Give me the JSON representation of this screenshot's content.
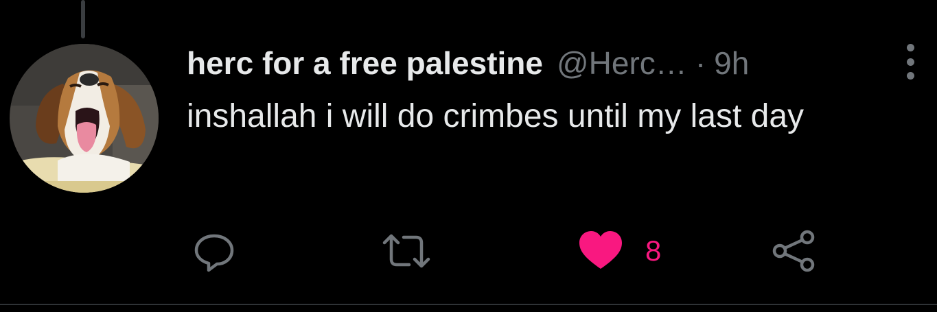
{
  "tweet": {
    "display_name": "herc for a free palestine",
    "handle": "@Herc…",
    "separator": "·",
    "timestamp": "9h",
    "text": "inshallah i will do crimbes until my last day",
    "like_count": "8"
  },
  "icons": {
    "avatar": "beagle-dog-photo",
    "more": "more-vertical-icon",
    "reply": "reply-bubble-icon",
    "retweet": "retweet-icon",
    "like": "heart-filled-icon",
    "share": "share-icon"
  },
  "colors": {
    "background": "#000000",
    "text_primary": "#e7e9ea",
    "text_secondary": "#71767b",
    "like_active": "#f91880"
  }
}
